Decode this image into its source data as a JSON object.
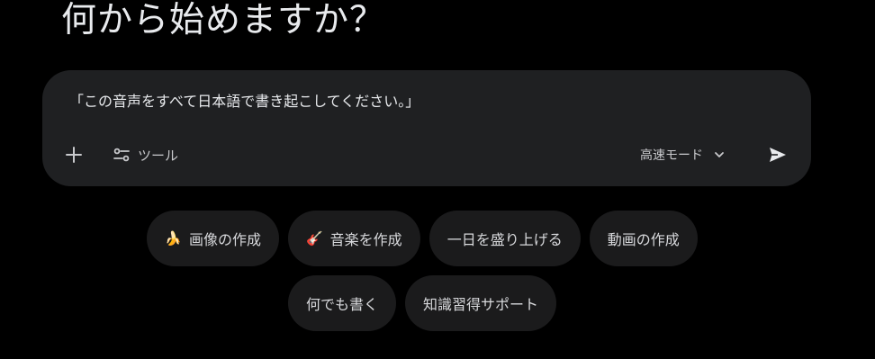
{
  "heading": "何から始めますか？",
  "composer": {
    "prompt_text": "「この音声をすべて日本語で書き起こしてください。」",
    "tools_label": "ツール",
    "mode_label": "高速モード",
    "icons": {
      "add": "plus-icon",
      "tools": "tools-sliders-icon",
      "mode": "chevron-down-icon",
      "send": "send-icon"
    }
  },
  "suggestions": [
    {
      "emoji": "🍌",
      "label": "画像の作成"
    },
    {
      "emoji": "🎸",
      "label": "音楽を作成"
    },
    {
      "emoji": "",
      "label": "一日を盛り上げる"
    },
    {
      "emoji": "",
      "label": "動画の作成"
    },
    {
      "emoji": "",
      "label": "何でも書く"
    },
    {
      "emoji": "",
      "label": "知識習得サポート"
    }
  ],
  "colors": {
    "background": "#000000",
    "composer_bg": "#1f2022",
    "chip_bg": "#1b1b1c",
    "text": "#e8eaed"
  }
}
